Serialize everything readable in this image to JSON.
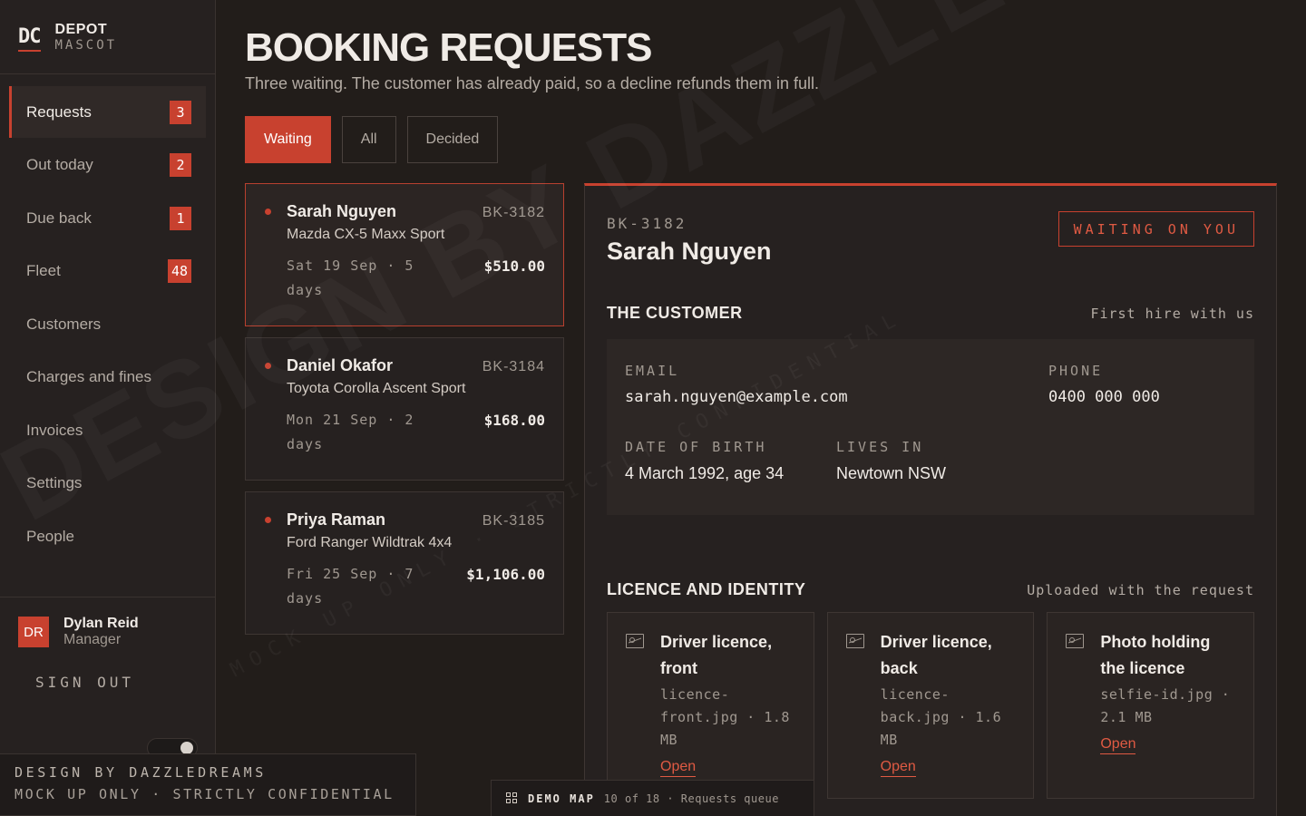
{
  "brand": {
    "logo": "DC",
    "name": "DEPOT",
    "tagline": "MASCOT"
  },
  "nav": [
    {
      "label": "Requests",
      "badge": "3"
    },
    {
      "label": "Out today",
      "badge": "2"
    },
    {
      "label": "Due back",
      "badge": "1"
    },
    {
      "label": "Fleet",
      "badge": "48"
    },
    {
      "label": "Customers",
      "badge": null
    },
    {
      "label": "Charges and fines",
      "badge": null
    },
    {
      "label": "Invoices",
      "badge": null
    },
    {
      "label": "Settings",
      "badge": null
    },
    {
      "label": "People",
      "badge": null
    }
  ],
  "user": {
    "initials": "DR",
    "name": "Dylan Reid",
    "role": "Manager",
    "signout": "SIGN OUT"
  },
  "page": {
    "title": "BOOKING REQUESTS",
    "subtitle": "Three waiting. The customer has already paid, so a decline refunds them in full."
  },
  "tabs": [
    {
      "label": "Waiting"
    },
    {
      "label": "All"
    },
    {
      "label": "Decided"
    }
  ],
  "requests": [
    {
      "name": "Sarah Nguyen",
      "id": "BK-3182",
      "car": "Mazda CX-5 Maxx Sport",
      "date": "Sat 19 Sep · 5 days",
      "price": "$510.00"
    },
    {
      "name": "Daniel Okafor",
      "id": "BK-3184",
      "car": "Toyota Corolla Ascent Sport",
      "date": "Mon 21 Sep · 2 days",
      "price": "$168.00"
    },
    {
      "name": "Priya Raman",
      "id": "BK-3185",
      "car": "Ford Ranger Wildtrak 4x4",
      "date": "Fri 25 Sep · 7 days",
      "price": "$1,106.00"
    }
  ],
  "detail": {
    "id": "BK-3182",
    "name": "Sarah Nguyen",
    "status": "WAITING ON YOU",
    "customer_section": {
      "title": "THE CUSTOMER",
      "note": "First hire with us"
    },
    "email_label": "EMAIL",
    "email": "sarah.nguyen@example.com",
    "phone_label": "PHONE",
    "phone": "0400 000 000",
    "dob_label": "DATE OF BIRTH",
    "dob": "4 March 1992, age 34",
    "lives_label": "LIVES IN",
    "lives": "Newtown NSW",
    "licence_section": {
      "title": "LICENCE AND IDENTITY",
      "note": "Uploaded with the request"
    },
    "docs": [
      {
        "title": "Driver licence, front",
        "file": "licence-front.jpg · 1.8 MB",
        "open": "Open"
      },
      {
        "title": "Driver licence, back",
        "file": "licence-back.jpg · 1.6 MB",
        "open": "Open"
      },
      {
        "title": "Photo holding the licence",
        "file": "selfie-id.jpg · 2.1 MB",
        "open": "Open"
      }
    ]
  },
  "footer": {
    "wm_line1": "DESIGN BY DAZZLEDREAMS",
    "wm_line2": "MOCK UP ONLY · STRICTLY CONFIDENTIAL",
    "demo_label": "DEMO MAP",
    "demo_info": "10 of 18 · Requests queue"
  },
  "overlay": {
    "big": "DESIGN BY DAZZLEDREAMS",
    "small": "MOCK UP ONLY · STRICTLY CONFIDENTIAL"
  },
  "colors": {
    "accent": "#c8412f",
    "background": "#221d1a",
    "panel": "#262120"
  }
}
